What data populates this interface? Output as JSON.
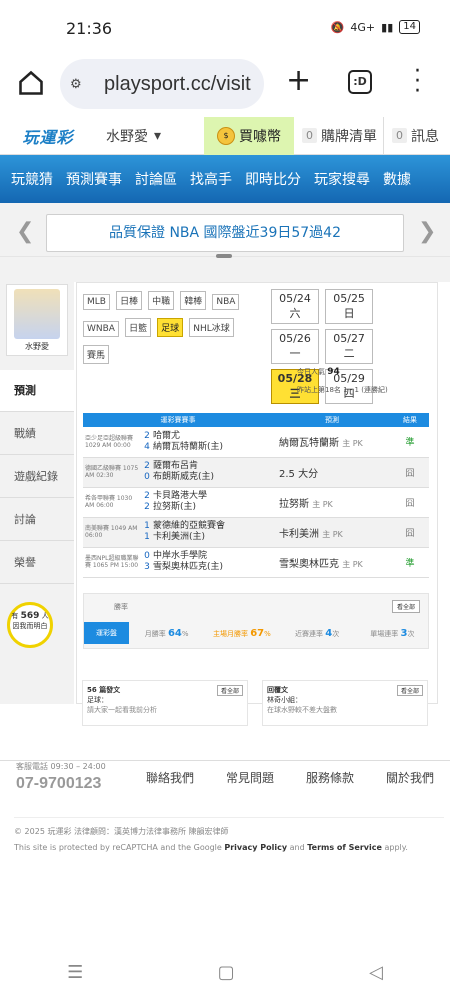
{
  "status": {
    "time": "21:36",
    "battery": "14",
    "network": "4G+"
  },
  "browser": {
    "url": "playsport.cc/visit",
    "tabs_label": ":D"
  },
  "site": {
    "logo": "玩運彩",
    "username": "水野愛",
    "buy_label": "買噱幣",
    "cart_count": "0",
    "cart_label": "購牌清單",
    "msg_count": "0",
    "msg_label": "訊息"
  },
  "nav": [
    "玩競猜",
    "預測賽事",
    "討論區",
    "找高手",
    "即時比分",
    "玩家搜尋",
    "數據"
  ],
  "banner": {
    "text": "品質保證 NBA 國際盤近39日57過42"
  },
  "sidebar": {
    "avatar_name": "水野愛",
    "items": [
      "預測",
      "戰績",
      "遊戲紀錄",
      "討論",
      "榮譽"
    ],
    "helped_pre": "有",
    "helped_count": "569",
    "helped_unit": "人",
    "helped_post": "因我而明白"
  },
  "leagues": [
    "MLB",
    "日棒",
    "中職",
    "韓棒",
    "NBA",
    "WNBA",
    "日籃",
    "足球",
    "NHL冰球",
    "賽馬"
  ],
  "selected_league": "足球",
  "dates": [
    "05/24 六",
    "05/25 日",
    "05/26 一",
    "05/27 二",
    "05/28 三",
    "05/29 四"
  ],
  "selected_date": "05/28 三",
  "stats": {
    "pop_label": "今日人氣",
    "pop_value": "94",
    "rank_text": "昨站上第18名 1 - 1 (連勝紀)"
  },
  "table": {
    "headers": [
      "運彩賽賽事",
      "預測",
      "結果"
    ],
    "rows": [
      {
        "meta": "亞少足亞超級聯賽 1029 AM 00:00",
        "s1": "2",
        "s2": "4",
        "t1": "哈爾尤",
        "t2": "納爾瓦特蘭斯(主)",
        "pick": "納爾瓦特蘭斯",
        "tag": "主 PK",
        "result": "準"
      },
      {
        "meta": "德國乙級聯賽 1075 AM 02:30",
        "s1": "2",
        "s2": "0",
        "t1": "薩爾布呂肯",
        "t2": "布朗斯威克(主)",
        "pick": "2.5 大分",
        "tag": "",
        "result": "囧"
      },
      {
        "meta": "希各甲聯賽 1030 AM 06:00",
        "s1": "2",
        "s2": "2",
        "t1": "卡貝路港大學",
        "t2": "拉努斯(主)",
        "pick": "拉努斯",
        "tag": "主 PK",
        "result": "囧"
      },
      {
        "meta": "南美聯賽 1049 AM 06:00",
        "s1": "1",
        "s2": "1",
        "t1": "蒙德維的亞競賽會",
        "t2": "卡利美洲(主)",
        "pick": "卡利美洲",
        "tag": "主 PK",
        "result": "囧"
      },
      {
        "meta": "墨西NPL超級職業聯賽 1065 PM 15:00",
        "s1": "0",
        "s2": "3",
        "t1": "中岸水手學院",
        "t2": "雪梨奧林匹克(主)",
        "pick": "雪梨奧林匹克",
        "tag": "主 PK",
        "result": "準"
      }
    ]
  },
  "rate": {
    "title": "勝率",
    "more": "看全部",
    "pill": "運彩盤",
    "month_label": "月勝率",
    "month_value": "64",
    "season_label": "主場月勝率",
    "season_value": "67",
    "streak_label": "近賽連率",
    "streak_value": "4",
    "max_label": "單場連率",
    "max_value": "3"
  },
  "articles": {
    "left_count": "56",
    "left_title": "篇發文",
    "left_more": "看全部",
    "left_item": "足球：",
    "left_sub": "請大家一起看我前分析",
    "right_title": "回覆文",
    "right_more": "看全部",
    "right_item": "林奇小組：",
    "right_sub": "在球水野較不差大盤數"
  },
  "footer": {
    "tel_label": "客服電話 09:30 – 24:00",
    "tel": "07-9700123",
    "links": [
      "聯絡我們",
      "常見問題",
      "服務條款",
      "關於我們"
    ],
    "copyright": "© 2025 玩運彩 法律顧問：漢英博力法律事務所 陳韻宏律師",
    "recaptcha_pre": "This site is protected by reCAPTCHA and the Google",
    "privacy": "Privacy Policy",
    "and": "and",
    "terms": "Terms of Service",
    "apply": "apply."
  }
}
